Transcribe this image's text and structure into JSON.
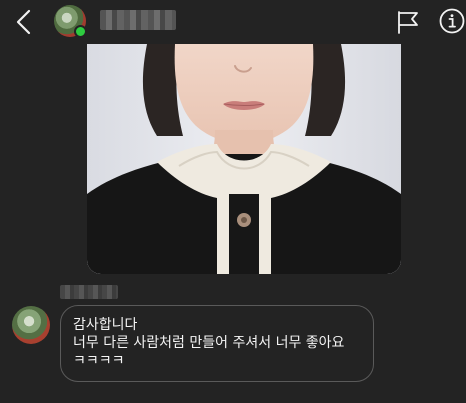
{
  "header": {
    "back_icon": "chevron-left-icon",
    "flag_icon": "flag-icon",
    "info_icon": "info-icon",
    "online_status_color": "#2ecc40"
  },
  "message": {
    "lines": [
      "감사합니다",
      "너무 다른 사람처럼 만들어 주셔서 너무 좋아요",
      "ㅋㅋㅋㅋ"
    ]
  }
}
